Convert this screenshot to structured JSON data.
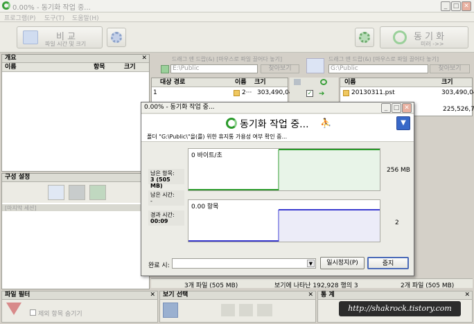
{
  "window": {
    "title": "0.00% - 동기화 작업 중..."
  },
  "menu": {
    "items": [
      "프로그램(P)",
      "도구(T)",
      "도움말(H)"
    ]
  },
  "toolbar": {
    "compare_title": "비 교",
    "compare_sub": "파일 시간 및 크기",
    "sync_title": "동 기 화",
    "sync_sub": "미러 ->>"
  },
  "overview": {
    "title": "개요",
    "col_name": "이름",
    "col_items": "항목",
    "col_size": "크기"
  },
  "config": {
    "title": "구성 설정",
    "row": "[마지막 세션]"
  },
  "left_folder": {
    "hint": "드래그 앤 드랍(&) [마우스로 파일 끌어다 놓기]",
    "path": "E:\\Public",
    "browse": "찾아보기"
  },
  "right_folder": {
    "hint": "드래그 앤 드랍(&) [마우스로 파일 끌어다 놓기]",
    "path": "G:\\Public",
    "browse": "찾아보기"
  },
  "left_table": {
    "headers": [
      "대상 경로",
      "이름",
      "크기"
    ],
    "rows": [
      {
        "num": "1",
        "path": "",
        "name": "2···",
        "size": "303,490,04"
      }
    ]
  },
  "right_table": {
    "headers": [
      "이름",
      "크기"
    ],
    "rows": [
      {
        "name": "20130311.pst",
        "size": "303,490,048"
      },
      {
        "name": "",
        "size": "225,526,784"
      }
    ]
  },
  "dialog": {
    "title": "0.00% - 동기화 작업 중...",
    "heading": "동기화 작업 중...",
    "status": "폴더 \"G:\\Public\\\"을(를) 위한 휴지통 가용성 여부 확인 중...",
    "speed": "0 바이트/초",
    "remaining_items_label": "남은 항목:",
    "remaining_items_value": "3 (505 MB)",
    "data_right": "256 MB",
    "remaining_time_label": "남은 시간:",
    "remaining_time_value": "-",
    "elapsed_label": "경과 시간:",
    "elapsed_value": "00:09",
    "items_label": "0.00 항목",
    "items_right": "2",
    "on_complete_label": "완료 시:",
    "pause": "일시정지(P)",
    "stop": "중지"
  },
  "statusbar": {
    "left": "3개 파일 (505 MB)",
    "middle": "보기에 나타난 192,928 행의 3",
    "right": "2개 파일 (505 MB)"
  },
  "bottom": {
    "filter_title": "파일 필터",
    "hide_excluded": "제외 항목 숨기기",
    "view_title": "보기 선택",
    "stats_title": "통 계",
    "watermark": "http://shakrock.tistory.com"
  },
  "colors": {
    "accent_green": "#2a9a2a",
    "graph_blue": "#3a3ad0",
    "arrow_blue": "#3868c8"
  }
}
